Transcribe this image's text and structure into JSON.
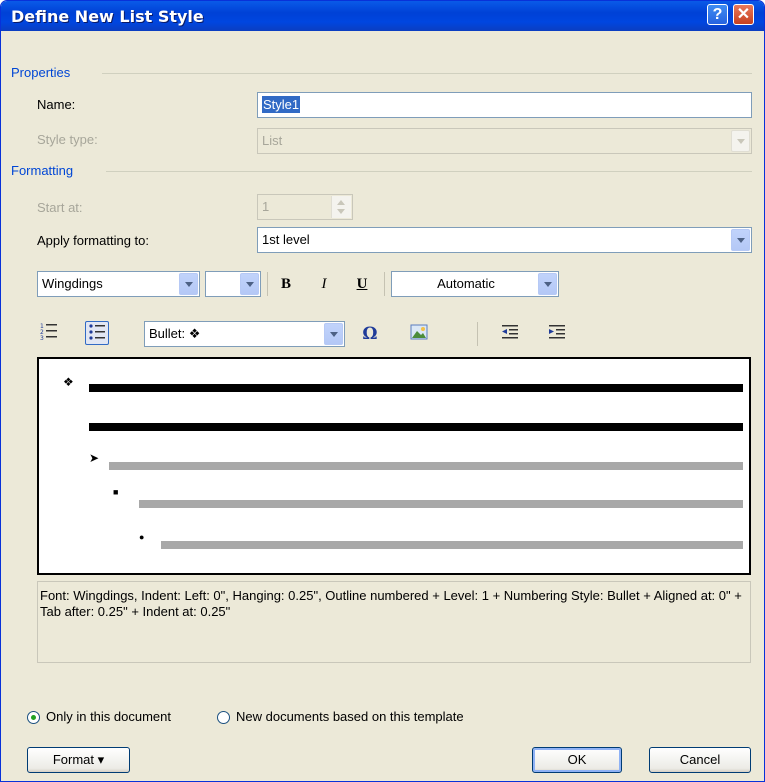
{
  "window": {
    "title": "Define New List Style",
    "help": "?",
    "close": "✕"
  },
  "properties": {
    "section_label": "Properties",
    "name_label": "Name:",
    "name_value": "Style1",
    "style_type_label": "Style type:",
    "style_type_value": "List"
  },
  "formatting": {
    "section_label": "Formatting",
    "start_at_label": "Start at:",
    "start_at_value": "1",
    "apply_label": "Apply formatting to:",
    "apply_value": "1st level",
    "font_value": "Wingdings",
    "size_value": "",
    "bold": "B",
    "italic": "I",
    "underline": "U",
    "color_value": "Automatic",
    "bullet_value": "Bullet:  ❖",
    "symbol_glyph": "Ω"
  },
  "preview": {
    "bullets": [
      "❖",
      "➤",
      "■",
      "●"
    ]
  },
  "description": "Font: Wingdings, Indent: Left:  0\", Hanging:  0.25\", Outline numbered + Level: 1 + Numbering Style: Bullet + Aligned at:  0\" + Tab after:  0.25\" + Indent at:  0.25\"",
  "scope": {
    "only_doc_label": "Only in this document",
    "template_label": "New documents based on this template",
    "selected": "only_doc"
  },
  "buttons": {
    "format": "Format ▾",
    "ok": "OK",
    "cancel": "Cancel"
  },
  "icons": [
    "numbering-icon",
    "bullets-icon",
    "symbol-icon",
    "picture-icon",
    "decrease-indent-icon",
    "increase-indent-icon"
  ]
}
